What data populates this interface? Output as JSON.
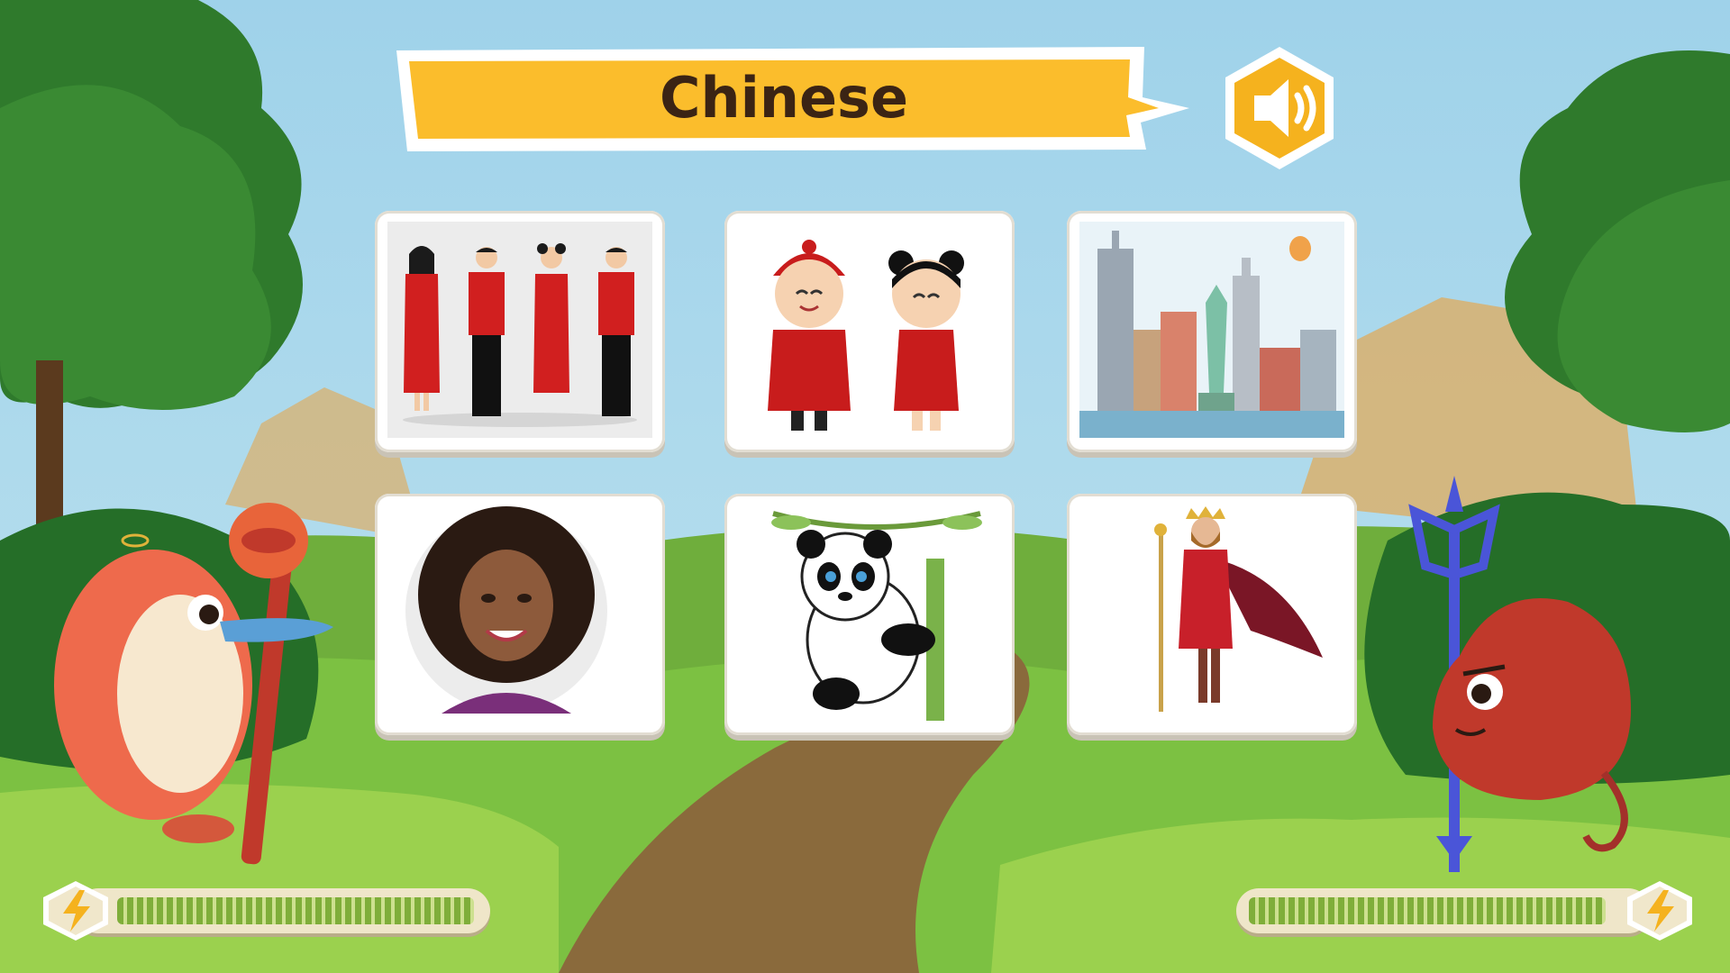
{
  "title": {
    "text": "Chinese"
  },
  "sound_button": {
    "icon": "speaker-icon"
  },
  "cards": [
    {
      "name": "card-chinese-adults",
      "subject": "chinese-adults"
    },
    {
      "name": "card-chinese-children",
      "subject": "chinese-children"
    },
    {
      "name": "card-new-york-city",
      "subject": "new-york-city"
    },
    {
      "name": "card-woman-curly-hair",
      "subject": "woman-curly-hair"
    },
    {
      "name": "card-panda",
      "subject": "panda"
    },
    {
      "name": "card-king",
      "subject": "king"
    }
  ],
  "player": {
    "character": "platypus",
    "energy": 1.0
  },
  "opponent": {
    "character": "red-monster",
    "energy": 1.0
  },
  "colors": {
    "banner": "#fbbd2c",
    "sound_button": "#f5b21e",
    "energy_fill": "#7fae3a"
  }
}
